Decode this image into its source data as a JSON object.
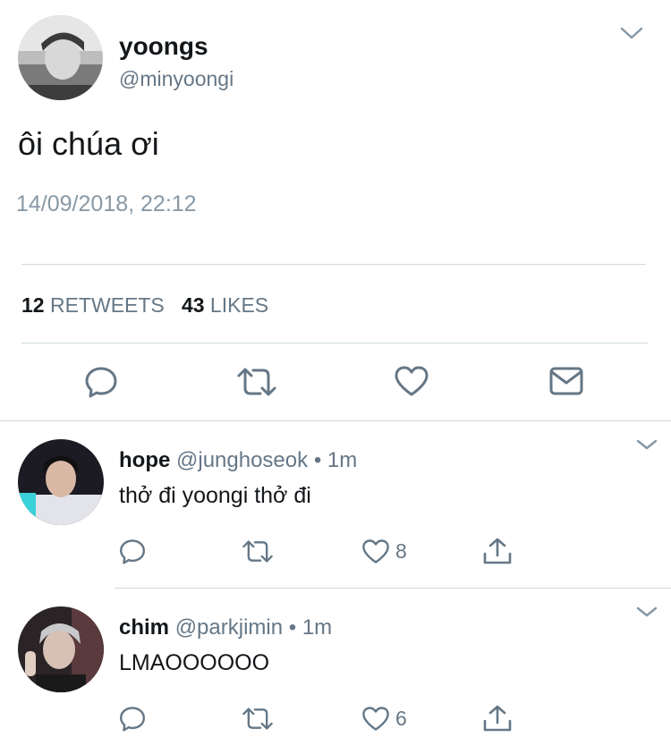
{
  "tweet": {
    "display_name": "yoongs",
    "handle": "@minyoongi",
    "text": "ôi chúa ơi",
    "timestamp": "14/09/2018, 22:12",
    "retweets_count": "12",
    "retweets_label": "RETWEETS",
    "likes_count": "43",
    "likes_label": "LIKES",
    "actions": [
      "reply-icon",
      "retweet-icon",
      "like-icon",
      "direct-message-icon"
    ]
  },
  "replies": [
    {
      "display_name": "hope",
      "handle": "@junghoseok",
      "separator": "•",
      "time": "1m",
      "text": "thở đi yoongi thở đi",
      "like_count": "8"
    },
    {
      "display_name": "chim",
      "handle": "@parkjimin",
      "separator": "•",
      "time": "1m",
      "text": "LMAOOOOOO",
      "like_count": "6"
    }
  ],
  "colors": {
    "text_primary": "#14171a",
    "text_secondary": "#657786",
    "timestamp": "#8899a6",
    "icon": "#657786",
    "divider": "#cfd9de"
  }
}
